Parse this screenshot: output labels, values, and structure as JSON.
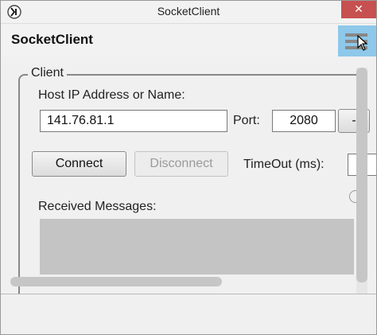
{
  "window": {
    "title": "SocketClient",
    "close_glyph": "✕"
  },
  "header": {
    "title": "SocketClient",
    "menu_icon": "hamburger-menu-icon"
  },
  "client": {
    "group_label": "Client",
    "host_label": "Host IP Address or Name:",
    "host_value": "141.76.81.1",
    "port_label": "Port:",
    "port_value": "2080",
    "connect_label": "Connect",
    "disconnect_label": "Disconnect",
    "timeout_label": "TimeOut (ms):",
    "received_label": "Received Messages:"
  },
  "colors": {
    "accent": "#8ec8ea",
    "close": "#c75050",
    "messages_bg": "#c4c4c4"
  }
}
